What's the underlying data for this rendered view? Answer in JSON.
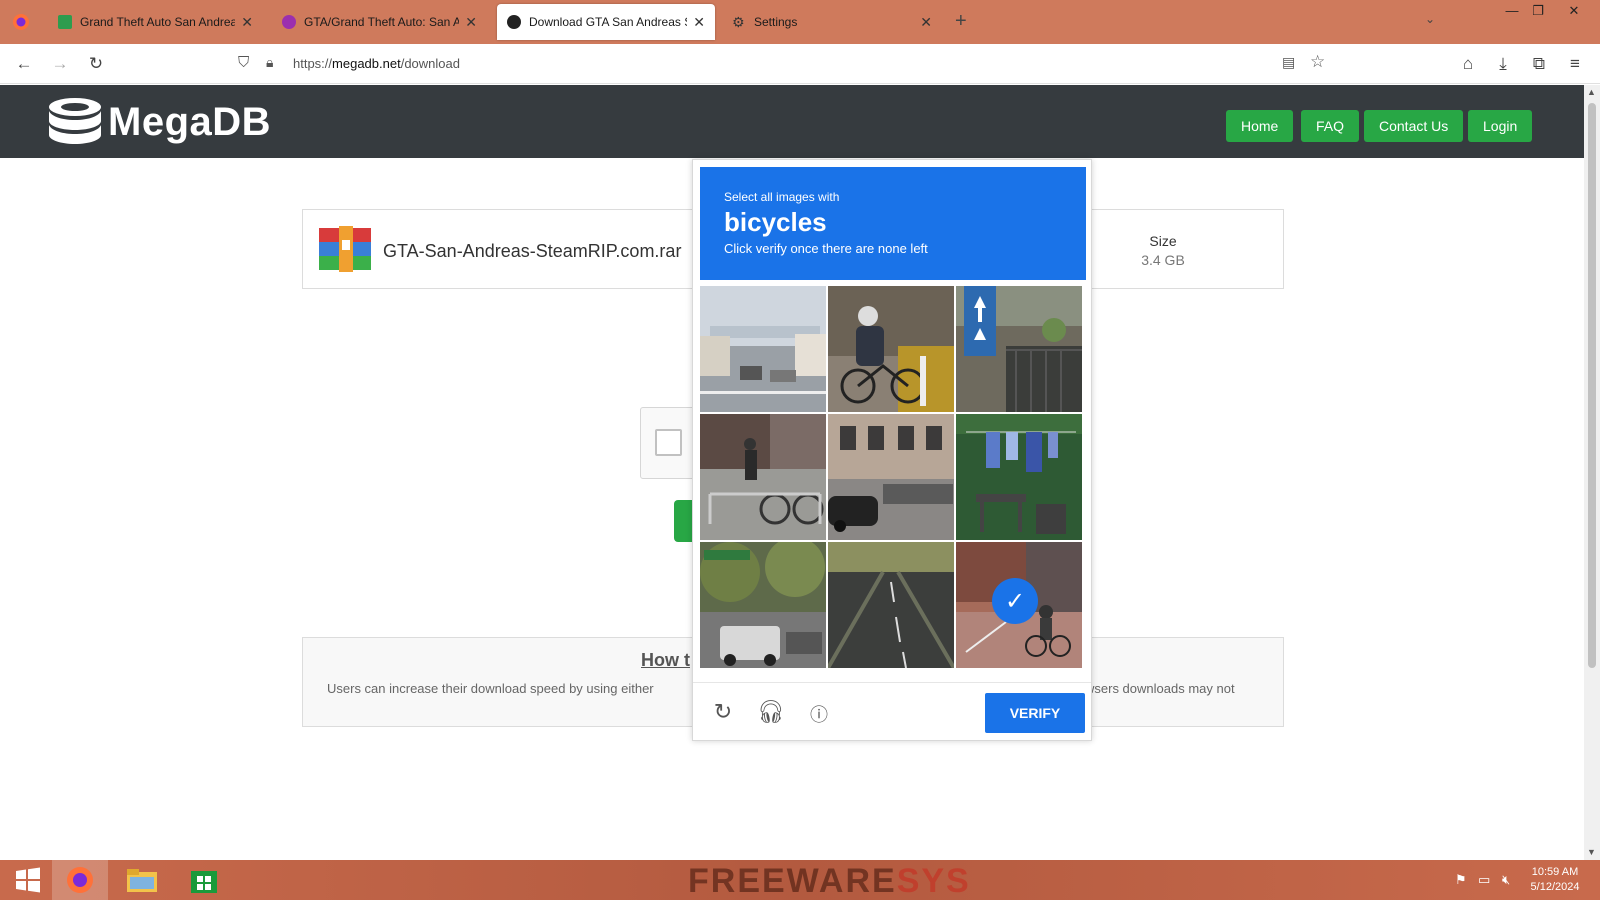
{
  "browser": {
    "tabs": [
      {
        "title": "Grand Theft Auto San Andreas",
        "favicon_color": "#2e9c4e"
      },
      {
        "title": "GTA/Grand Theft Auto: San An",
        "favicon_color": "#9b2fae"
      },
      {
        "title": "Download GTA San Andreas St",
        "favicon_color": "#222222"
      },
      {
        "title": "Settings",
        "favicon_color": "#555555"
      }
    ],
    "url_prefix": "https://",
    "url_domain": "megadb.net",
    "url_path": "/download"
  },
  "site": {
    "logo_text": "MegaDB",
    "nav": [
      "Home",
      "FAQ",
      "Contact Us",
      "Login"
    ],
    "accent_color": "#28a745",
    "header_color": "#363b3f"
  },
  "file": {
    "name": "GTA-San-Andreas-SteamRIP.com.rar",
    "size_label": "Size",
    "size_value": "3.4 GB"
  },
  "info": {
    "title_partial": "How t",
    "text_left": "Users can increase their download speed by using either",
    "text_right": "wsers downloads may not"
  },
  "captcha": {
    "instruction": "Select all images with",
    "object": "bicycles",
    "hint": "Click verify once there are none left",
    "verify_label": "VERIFY",
    "accent_color": "#1a73e8",
    "tiles": [
      {
        "scene": "street-overpass",
        "selected": false
      },
      {
        "scene": "cyclist-sidewalk",
        "selected": false
      },
      {
        "scene": "road-sign-fence",
        "selected": false
      },
      {
        "scene": "bike-rack-pedestrian",
        "selected": false
      },
      {
        "scene": "parked-cars-building",
        "selected": false
      },
      {
        "scene": "clothesline-yard",
        "selected": false
      },
      {
        "scene": "trees-street-van",
        "selected": false
      },
      {
        "scene": "empty-road",
        "selected": false
      },
      {
        "scene": "cyclist-bike-lane",
        "selected": true
      }
    ]
  },
  "taskbar": {
    "watermark_a": "FREEWARE",
    "watermark_b": "SYS",
    "time": "10:59 AM",
    "date": "5/12/2024"
  }
}
